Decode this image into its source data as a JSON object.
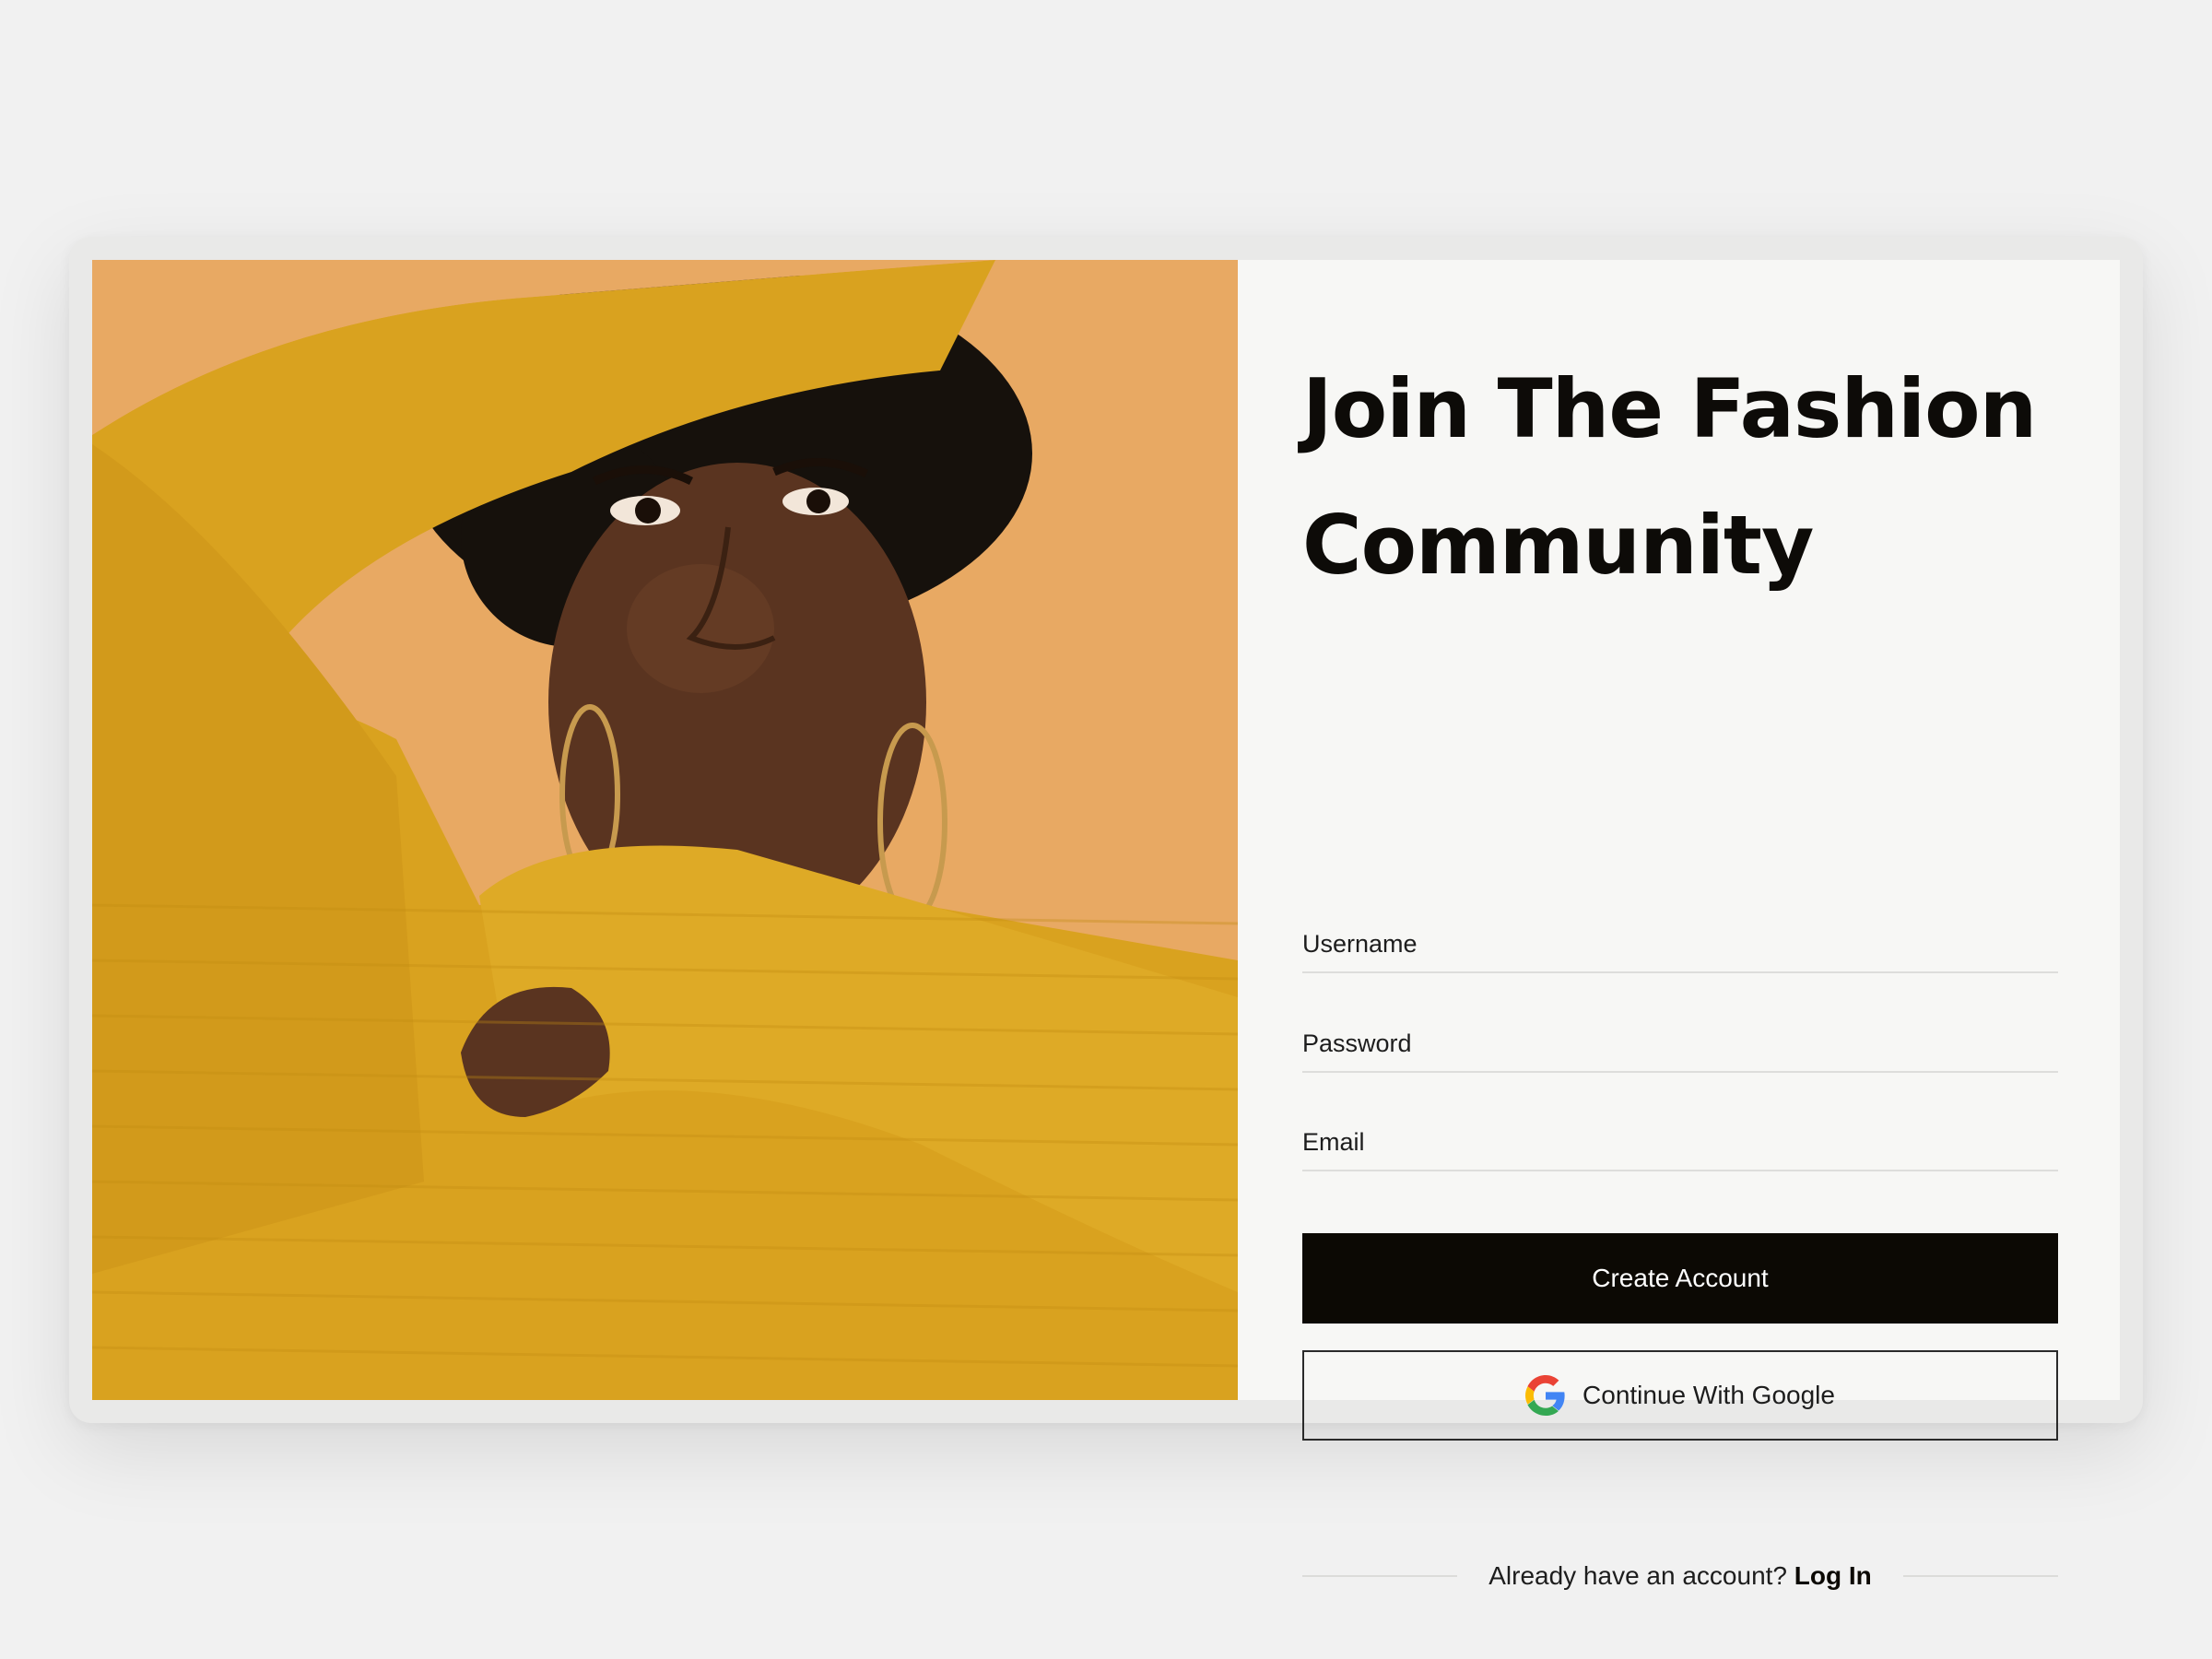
{
  "signup": {
    "title": "Join The Fashion Community",
    "fields": {
      "username_placeholder": "Username",
      "password_placeholder": "Password",
      "email_placeholder": "Email"
    },
    "create_account_label": "Create Account",
    "google_label": "Continue With Google",
    "login_prompt": "Already have an account?",
    "login_link": "Log In"
  },
  "photo": {
    "icon": "portrait-photo",
    "colors": {
      "background": "#e8a963",
      "sweater": "#d9a21f",
      "skin": "#5a3420",
      "hair": "#16110c"
    }
  },
  "theme": {
    "primary_button": "#0c0904",
    "panel_background": "#f7f7f5",
    "page_background": "#f1f1f1"
  }
}
